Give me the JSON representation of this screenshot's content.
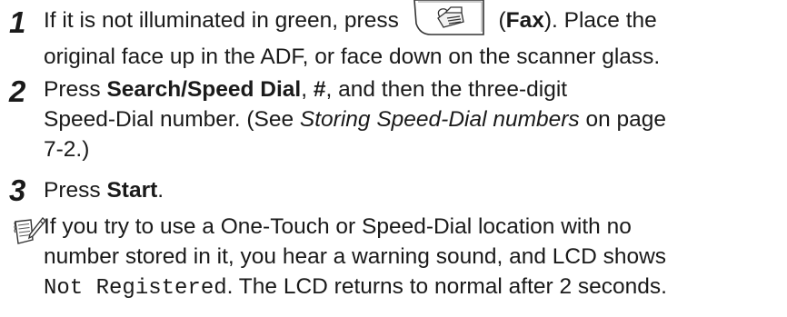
{
  "steps": [
    {
      "number": "1",
      "line1_a": "If it is not illuminated in green, press ",
      "key_icon": "fax-key-icon",
      "line1_b_open": " (",
      "line1_b_bold": "Fax",
      "line1_b_close": "). Place the",
      "line2": "original face up in the ADF, or face down on the scanner glass."
    },
    {
      "number": "2",
      "line1_a": "Press ",
      "line1_bold1": "Search/Speed Dial",
      "line1_mid": ", ",
      "line1_bold2": "#",
      "line1_end": ", and then the three-digit",
      "line2_a": "Speed-Dial number. (See ",
      "line2_italic": "Storing Speed-Dial numbers",
      "line2_b": " on page",
      "line3": "7-2.)"
    },
    {
      "number": "3",
      "line1_a": "Press ",
      "line1_bold": "Start",
      "line1_end": "."
    }
  ],
  "note": {
    "icon": "note-pencil-icon",
    "line1": "If you try to use a One-Touch or Speed-Dial location with no",
    "line2": "number stored in it, you hear a warning sound, and LCD shows",
    "line3_mono": "Not Registered",
    "line3_rest": ". The LCD returns to normal after 2 seconds."
  }
}
